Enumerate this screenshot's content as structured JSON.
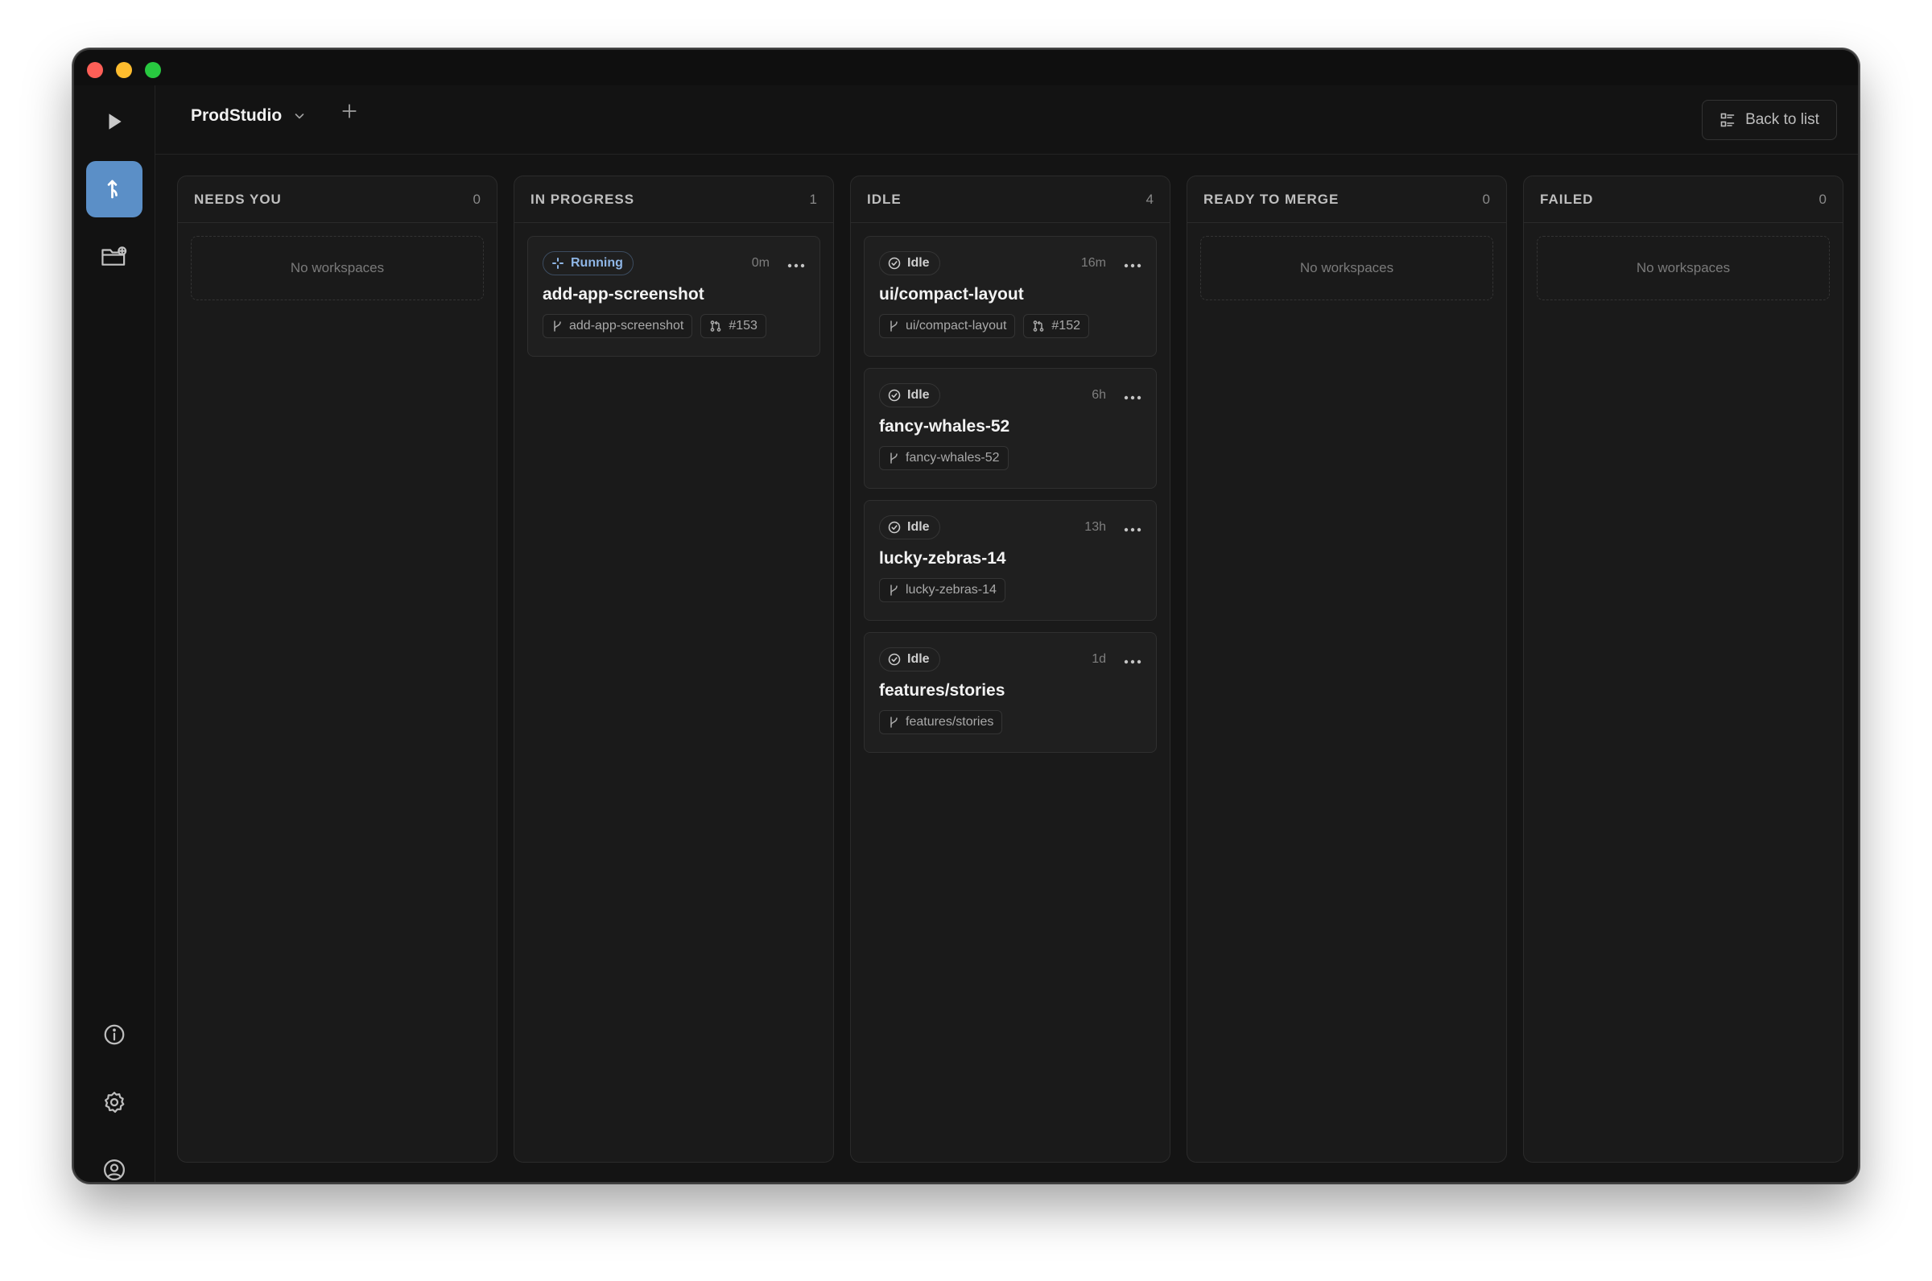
{
  "window": {
    "project_name": "ProdStudio",
    "back_to_list": "Back to list"
  },
  "sidebar": {
    "items": [
      {
        "icon": "play-icon",
        "active": false
      },
      {
        "icon": "branch-icon",
        "active": true
      },
      {
        "icon": "folder-add-icon",
        "active": false
      },
      {
        "icon": "info-icon",
        "active": false
      },
      {
        "icon": "gear-icon",
        "active": false
      },
      {
        "icon": "user-icon",
        "active": false
      }
    ]
  },
  "colors": {
    "accent": "#5b8fc7",
    "running": "#8fb6e6",
    "background": "#141414"
  },
  "columns": [
    {
      "title": "NEEDS YOU",
      "count": "0",
      "empty_text": "No workspaces"
    },
    {
      "title": "IN PROGRESS",
      "count": "1",
      "cards": [
        {
          "status": "Running",
          "age": "0m",
          "title": "add-app-screenshot",
          "branch": "add-app-screenshot",
          "pr": "#153"
        }
      ]
    },
    {
      "title": "IDLE",
      "count": "4",
      "cards": [
        {
          "status": "Idle",
          "age": "16m",
          "title": "ui/compact-layout",
          "branch": "ui/compact-layout",
          "pr": "#152"
        },
        {
          "status": "Idle",
          "age": "6h",
          "title": "fancy-whales-52",
          "branch": "fancy-whales-52"
        },
        {
          "status": "Idle",
          "age": "13h",
          "title": "lucky-zebras-14",
          "branch": "lucky-zebras-14"
        },
        {
          "status": "Idle",
          "age": "1d",
          "title": "features/stories",
          "branch": "features/stories"
        }
      ]
    },
    {
      "title": "READY TO MERGE",
      "count": "0",
      "empty_text": "No workspaces"
    },
    {
      "title": "FAILED",
      "count": "0",
      "empty_text": "No workspaces"
    }
  ]
}
